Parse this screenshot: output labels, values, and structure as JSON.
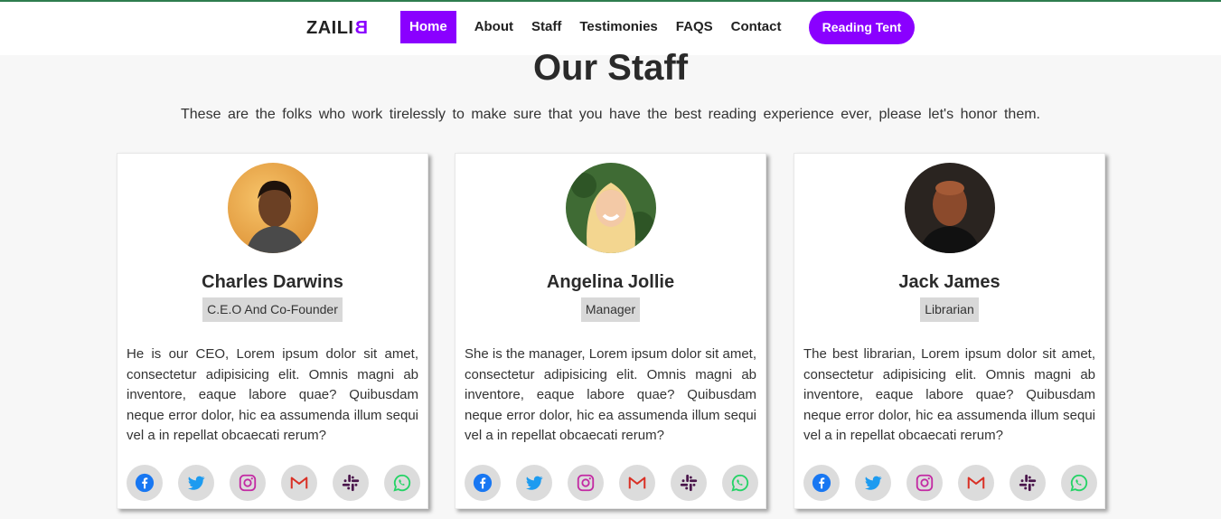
{
  "nav": {
    "brand_main": "ZAILI",
    "brand_flip": "B",
    "links": [
      "Home",
      "About",
      "Staff",
      "Testimonies",
      "FAQS",
      "Contact"
    ],
    "cta": "Reading Tent",
    "accent": "#8a00ff"
  },
  "section": {
    "title": "Our Staff",
    "subtitle": "These are the folks who work tirelessly to make sure that you have the best reading experience ever, please let's honor them."
  },
  "staff": [
    {
      "name": "Charles Darwins",
      "role": "C.E.O And Co-Founder",
      "bio": "He is our CEO, Lorem ipsum dolor sit amet, consectetur adipisicing elit. Omnis magni ab inventore, eaque labore quae? Quibusdam neque error dolor, hic ea assumenda illum sequi vel a in repellat obcaecati rerum?"
    },
    {
      "name": "Angelina Jollie",
      "role": "Manager",
      "bio": "She is the manager, Lorem ipsum dolor sit amet, consectetur adipisicing elit. Omnis magni ab inventore, eaque labore quae? Quibusdam neque error dolor, hic ea assumenda illum sequi vel a in repellat obcaecati rerum?"
    },
    {
      "name": "Jack James",
      "role": "Librarian",
      "bio": "The best librarian, Lorem ipsum dolor sit amet, consectetur adipisicing elit. Omnis magni ab inventore, eaque labore quae? Quibusdam neque error dolor, hic ea assumenda illum sequi vel a in repellat obcaecati rerum?"
    }
  ],
  "social_icons": [
    "facebook-icon",
    "twitter-icon",
    "instagram-icon",
    "gmail-icon",
    "slack-icon",
    "whatsapp-icon"
  ],
  "social_colors": {
    "facebook": "#1877f2",
    "twitter": "#1da1f2",
    "instagram": "#c32aa3",
    "gmail": "#d93025",
    "slack": "#4a154b",
    "whatsapp": "#25d366"
  }
}
